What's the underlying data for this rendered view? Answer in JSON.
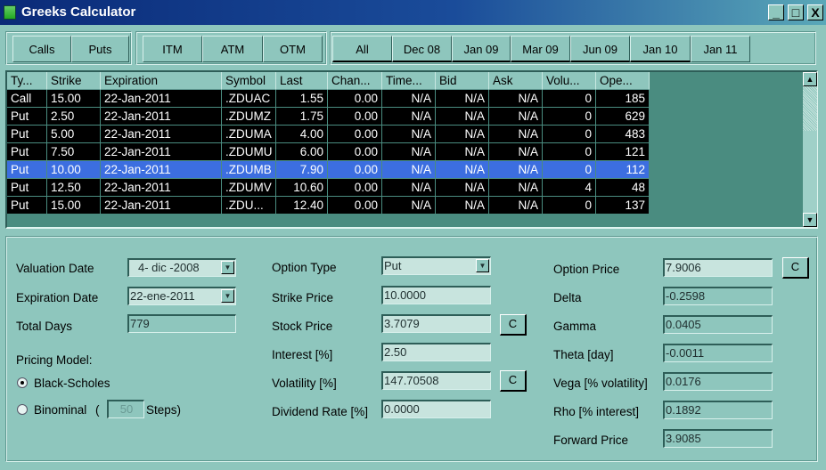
{
  "window": {
    "title": "Greeks Calculator",
    "min": "_",
    "max": "□",
    "close": "X"
  },
  "filters": {
    "type": [
      "Calls",
      "Puts"
    ],
    "moneyness": [
      "ITM",
      "ATM",
      "OTM"
    ],
    "expiries": [
      "All",
      "Dec 08",
      "Jan 09",
      "Mar 09",
      "Jun 09",
      "Jan 10",
      "Jan 11"
    ]
  },
  "table": {
    "columns": [
      "Ty...",
      "Strike",
      "Expiration",
      "Symbol",
      "Last",
      "Chan...",
      "Time...",
      "Bid",
      "Ask",
      "Volu...",
      "Ope..."
    ],
    "rows": [
      [
        "Call",
        "15.00",
        "22-Jan-2011",
        ".ZDUAC",
        "1.55",
        "0.00",
        "N/A",
        "N/A",
        "N/A",
        "0",
        "185"
      ],
      [
        "Put",
        "2.50",
        "22-Jan-2011",
        ".ZDUMZ",
        "1.75",
        "0.00",
        "N/A",
        "N/A",
        "N/A",
        "0",
        "629"
      ],
      [
        "Put",
        "5.00",
        "22-Jan-2011",
        ".ZDUMA",
        "4.00",
        "0.00",
        "N/A",
        "N/A",
        "N/A",
        "0",
        "483"
      ],
      [
        "Put",
        "7.50",
        "22-Jan-2011",
        ".ZDUMU",
        "6.00",
        "0.00",
        "N/A",
        "N/A",
        "N/A",
        "0",
        "121"
      ],
      [
        "Put",
        "10.00",
        "22-Jan-2011",
        ".ZDUMB",
        "7.90",
        "0.00",
        "N/A",
        "N/A",
        "N/A",
        "0",
        "112"
      ],
      [
        "Put",
        "12.50",
        "22-Jan-2011",
        ".ZDUMV",
        "10.60",
        "0.00",
        "N/A",
        "N/A",
        "N/A",
        "4",
        "48"
      ],
      [
        "Put",
        "15.00",
        "22-Jan-2011",
        ".ZDU...",
        "12.40",
        "0.00",
        "N/A",
        "N/A",
        "N/A",
        "0",
        "137"
      ]
    ],
    "selected_row": 4,
    "selected_color": "#3c6ee0"
  },
  "inputs": {
    "valuation_date": {
      "label": "Valuation Date",
      "value": "4- dic -2008"
    },
    "expiration_date": {
      "label": "Expiration Date",
      "value": "22-ene-2011"
    },
    "total_days": {
      "label": "Total Days",
      "value": "779"
    },
    "pricing_model_label": "Pricing Model:",
    "black_scholes": "Black-Scholes",
    "binominal": "Binominal",
    "paren_open": "(",
    "steps_value": "50",
    "steps_label": "Steps)",
    "option_type": {
      "label": "Option Type",
      "value": "Put"
    },
    "strike_price": {
      "label": "Strike Price",
      "value": "10.0000"
    },
    "stock_price": {
      "label": "Stock Price",
      "value": "3.7079"
    },
    "interest": {
      "label": "Interest [%]",
      "value": "2.50"
    },
    "volatility": {
      "label": "Volatility [%]",
      "value": "147.70508"
    },
    "dividend_rate": {
      "label": "Dividend Rate [%]",
      "value": "0.0000"
    },
    "calc_label": "C"
  },
  "outputs": [
    {
      "label": "Option Price",
      "value": "7.9006"
    },
    {
      "label": "Delta",
      "value": "-0.2598"
    },
    {
      "label": "Gamma",
      "value": "0.0405"
    },
    {
      "label": "Theta [day]",
      "value": "-0.0011"
    },
    {
      "label": "Vega [% volatility]",
      "value": "0.0176"
    },
    {
      "label": "Rho [% interest]",
      "value": "0.1892"
    },
    {
      "label": "Forward Price",
      "value": "3.9085"
    }
  ]
}
